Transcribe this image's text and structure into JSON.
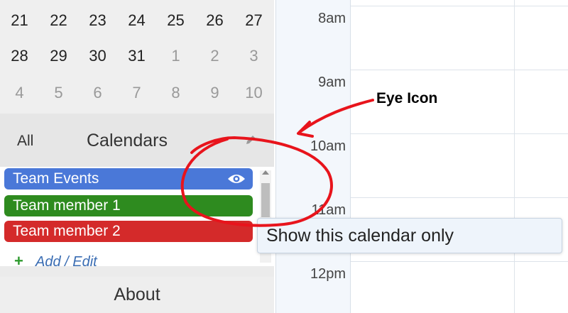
{
  "mini_calendar": {
    "rows": [
      [
        {
          "d": "21",
          "m": false
        },
        {
          "d": "22",
          "m": false
        },
        {
          "d": "23",
          "m": false
        },
        {
          "d": "24",
          "m": false
        },
        {
          "d": "25",
          "m": false
        },
        {
          "d": "26",
          "m": false
        },
        {
          "d": "27",
          "m": false
        }
      ],
      [
        {
          "d": "28",
          "m": false
        },
        {
          "d": "29",
          "m": false
        },
        {
          "d": "30",
          "m": false
        },
        {
          "d": "31",
          "m": false
        },
        {
          "d": "1",
          "m": true
        },
        {
          "d": "2",
          "m": true
        },
        {
          "d": "3",
          "m": true
        }
      ],
      [
        {
          "d": "4",
          "m": true
        },
        {
          "d": "5",
          "m": true
        },
        {
          "d": "6",
          "m": true
        },
        {
          "d": "7",
          "m": true
        },
        {
          "d": "8",
          "m": true
        },
        {
          "d": "9",
          "m": true
        },
        {
          "d": "10",
          "m": true
        }
      ]
    ]
  },
  "calendars_panel": {
    "all_label": "All",
    "title": "Calendars",
    "items": [
      {
        "label": "Team Events",
        "color": "#4a78d8",
        "show_eye": true
      },
      {
        "label": "Team member 1",
        "color": "#2e8b1f",
        "show_eye": false
      },
      {
        "label": "Team member 2",
        "color": "#d42a2a",
        "show_eye": false
      }
    ],
    "add_label": "Add / Edit"
  },
  "about_label": "About",
  "time_labels": [
    "8am",
    "9am",
    "10am",
    "11am",
    "12pm"
  ],
  "tooltip": "Show this calendar only",
  "annotation": {
    "label": "Eye Icon",
    "color": "#e8141c"
  }
}
